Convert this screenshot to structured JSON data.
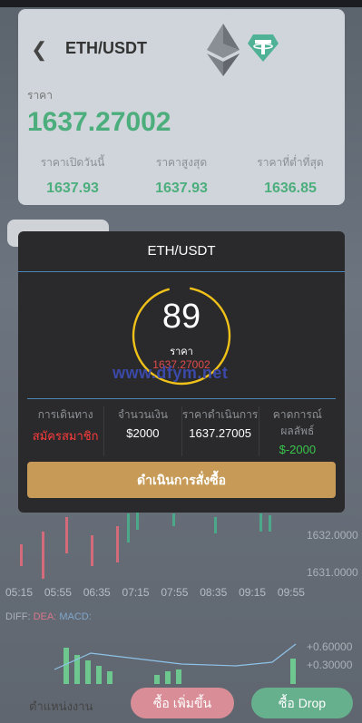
{
  "header": {
    "pair": "ETH/USDT"
  },
  "ticker": {
    "price_label": "ราคา",
    "price": "1637.27002",
    "stats": [
      {
        "label": "ราคาเปิดวันนี้",
        "value": "1637.93"
      },
      {
        "label": "ราคาสูงสุด",
        "value": "1637.93"
      },
      {
        "label": "ราคาที่ต่ำที่สุด",
        "value": "1636.85"
      }
    ]
  },
  "chart": {
    "y_labels": [
      "1632.0000",
      "1631.0000"
    ],
    "x_labels": [
      "05:15",
      "05:55",
      "06:35",
      "07:15",
      "07:55",
      "08:35",
      "09:15",
      "09:55"
    ],
    "indicator": {
      "diff": "DIFF:",
      "dea": "DEA:",
      "macd": "MACD:"
    },
    "macd_labels": [
      "+0.60000",
      "+0.30000"
    ]
  },
  "modal": {
    "title": "ETH/USDT",
    "countdown": "89",
    "price_label": "ราคา",
    "price": "1637.27002",
    "watermark": "www.dfym.net",
    "info": [
      {
        "label": "การเดินทาง",
        "value": "สมัครสมาชิก",
        "color": "#ff3b3b"
      },
      {
        "label": "จำนวนเงิน",
        "value": "$2000"
      },
      {
        "label": "ราคาดำเนินการ",
        "value": "1637.27005"
      },
      {
        "label": "คาดการณ์ ผลลัพธ์",
        "value": "$-2000",
        "color": "#39c64c"
      }
    ],
    "submit_label": "ดำเนินการสั่งซื้อ"
  },
  "bottom": {
    "position_label": "ตำแหน่งงาน",
    "buy_up_label": "ซื้อ เพิ่มขึ้น",
    "buy_down_label": "ซื้อ Drop"
  }
}
